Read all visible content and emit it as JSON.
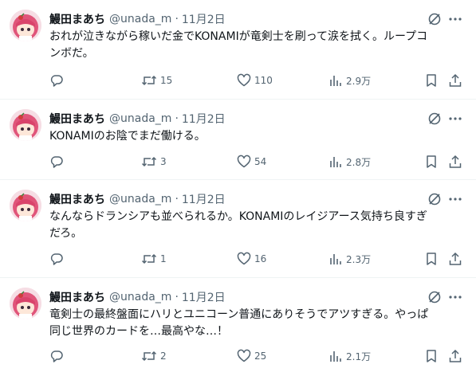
{
  "author": {
    "name": "鰻田まあち",
    "handle": "@unada_m"
  },
  "separator": "·",
  "tweets": [
    {
      "date": "11月2日",
      "line1": "おれが泣きながら稼いだ金でKONAMIが竜剣士を刷って涙を拭く。ループコ",
      "line2": "ンボだ。",
      "replies": "",
      "retweets": "15",
      "likes": "110",
      "views": "2.9万"
    },
    {
      "date": "11月2日",
      "line1": "KONAMIのお陰でまだ働ける。",
      "line2": "",
      "replies": "",
      "retweets": "3",
      "likes": "54",
      "views": "2.8万"
    },
    {
      "date": "11月2日",
      "line1": "なんならドランシアも並べられるか。KONAMIのレイジアース気持ち良すぎ",
      "line2": "だろ。",
      "replies": "",
      "retweets": "1",
      "likes": "16",
      "views": "2.3万"
    },
    {
      "date": "11月2日",
      "line1": "竜剣士の最終盤面にハリとユニコーン普通にありそうでアツすぎる。やっぱ",
      "line2": "同じ世界のカードを…最高やな…！",
      "replies": "",
      "retweets": "2",
      "likes": "25",
      "views": "2.1万"
    }
  ],
  "icons": {
    "reply": "reply-icon",
    "retweet": "retweet-icon",
    "like": "heart-icon",
    "views": "views-icon",
    "bookmark": "bookmark-icon",
    "share": "share-icon",
    "grok": "grok-icon",
    "more": "more-icon"
  },
  "colors": {
    "text": "#0f1419",
    "secondary": "#536471",
    "divider": "#eff3f4",
    "avatar_hair": "#e0557a"
  }
}
